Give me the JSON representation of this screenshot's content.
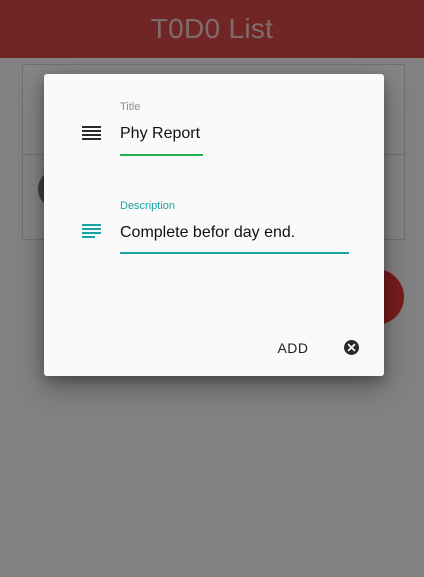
{
  "app_bar": {
    "title": "T0D0 List"
  },
  "dialog": {
    "title_field": {
      "label": "Title",
      "value": "Phy Report"
    },
    "description_field": {
      "label": "Description",
      "value": "Complete befor day end."
    },
    "add_button_label": "ADD",
    "close_icon": "close-circle-icon"
  },
  "colors": {
    "app_bar": "#d84848",
    "accent_teal": "#1aa3a3",
    "title_underline": "#22b14c",
    "fab": "#e53935"
  }
}
